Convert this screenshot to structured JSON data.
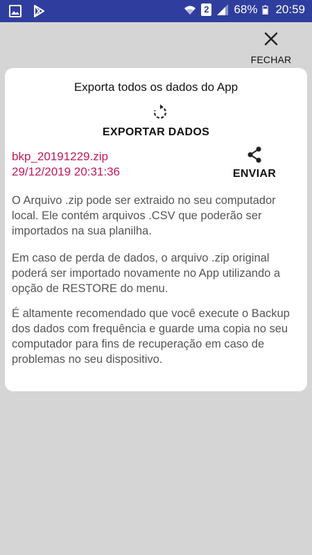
{
  "status_bar": {
    "left_icons": [
      "gallery-icon",
      "play-store-icon"
    ],
    "right_icons": [
      "wifi-icon",
      "sim-2-icon",
      "signal-icon",
      "battery-icon"
    ],
    "sim_label": "2",
    "battery": "68%",
    "time": "20:59"
  },
  "header": {
    "close_label": "FECHAR",
    "close_icon": "close-icon"
  },
  "card": {
    "title": "Exporta todos os dados do App",
    "export_icon": "export-refresh-icon",
    "export_label": "EXPORTAR DADOS",
    "file_name": "bkp_20191229.zip",
    "file_date": "29/12/2019 20:31:36",
    "share_icon": "share-icon",
    "share_label": "ENVIAR",
    "paragraphs": [
      "O Arquivo .zip pode ser extraido no seu computador local. Ele contém arquivos .CSV que poderão ser importados na sua planilha.",
      "Em caso de perda de dados, o arquivo .zip original poderá ser importado novamente no App utilizando a opção de RESTORE do menu.",
      "É altamente recomendado que você execute o Backup dos dados com frequência e guarde uma copia no seu computador para fins de recuperação em caso de problemas no seu dispositivo."
    ]
  },
  "colors": {
    "status_bar": "#2f3e9e",
    "file_text": "#c2185b",
    "backdrop": "#d5d5d5"
  }
}
